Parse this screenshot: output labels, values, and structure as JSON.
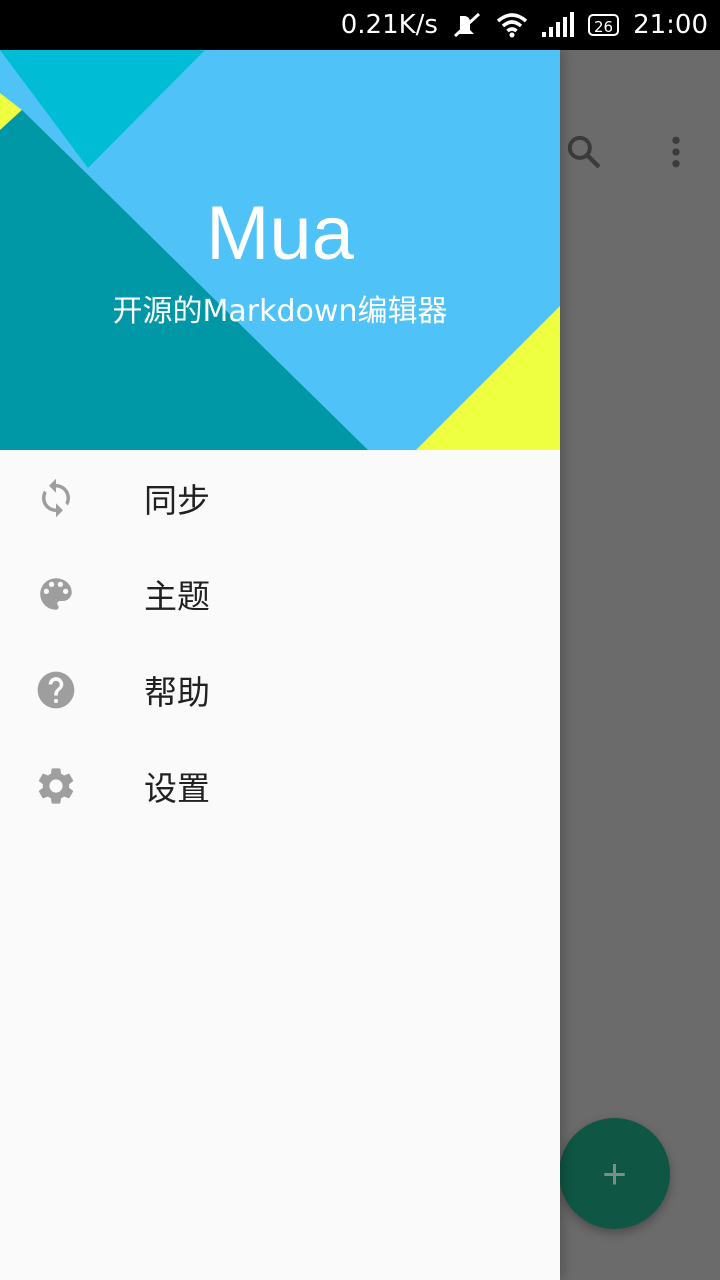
{
  "status_bar": {
    "network_speed": "0.21K/s",
    "battery_level": "26",
    "time": "21:00",
    "icons": [
      "mute-icon",
      "wifi-icon",
      "signal-icon",
      "battery-icon"
    ]
  },
  "app_bar": {
    "icons": [
      "search-icon",
      "more-vert-icon"
    ]
  },
  "drawer": {
    "header": {
      "app_name": "Mua",
      "subtitle": "开源的Markdown编辑器",
      "colors": {
        "light_blue": "#4fc3f7",
        "teal": "#0097a7",
        "cyan": "#00bcd4",
        "lime": "#eeff41"
      }
    },
    "menu": [
      {
        "label": "同步",
        "icon": "sync-icon"
      },
      {
        "label": "主题",
        "icon": "palette-icon"
      },
      {
        "label": "帮助",
        "icon": "help-icon"
      },
      {
        "label": "设置",
        "icon": "settings-icon"
      }
    ]
  },
  "fab": {
    "label": "+",
    "icon": "add-icon",
    "color": "#0f5645"
  }
}
